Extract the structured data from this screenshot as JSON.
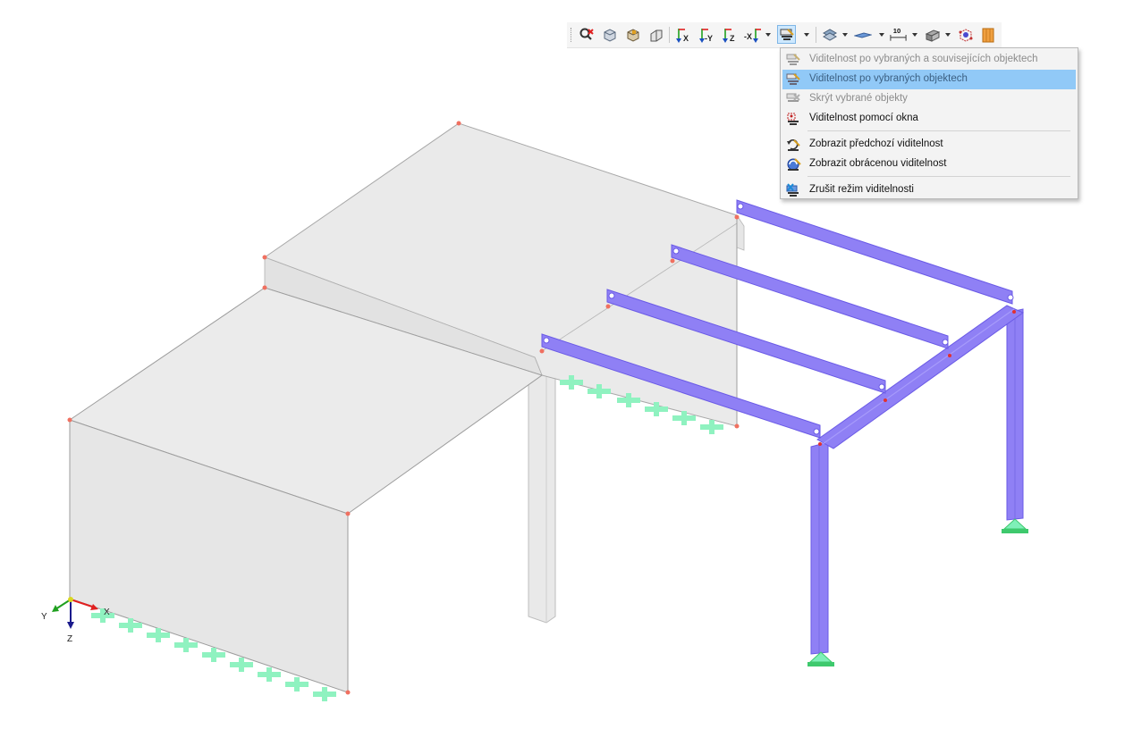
{
  "toolbar": {
    "buttons": [
      {
        "name": "hide-selection-icon"
      },
      {
        "name": "view-isometric-icon"
      },
      {
        "name": "view-box-icon"
      },
      {
        "name": "view-wire-icon"
      },
      {
        "name": "view-along-x-icon",
        "label": "X"
      },
      {
        "name": "view-along-y-icon",
        "label": "-Y"
      },
      {
        "name": "view-along-z-icon",
        "label": "Z"
      },
      {
        "name": "view-along-neg-x-icon",
        "label": "-X"
      },
      {
        "name": "visibility-mode-icon"
      },
      {
        "name": "display-surfaces-icon"
      },
      {
        "name": "display-plane-icon"
      },
      {
        "name": "dimension-icon",
        "label": "10"
      },
      {
        "name": "render-style-icon"
      },
      {
        "name": "wireframe-nodes-icon"
      },
      {
        "name": "solid-render-icon"
      }
    ]
  },
  "menu": {
    "items": [
      {
        "label": "Viditelnost po vybraných a souvisejících objektech",
        "state": "disabled",
        "icon": "visibility-related-icon"
      },
      {
        "label": "Viditelnost po vybraných objektech",
        "state": "highlighted",
        "icon": "visibility-selected-icon"
      },
      {
        "label": "Skrýt vybrané objekty",
        "state": "disabled",
        "icon": "hide-objects-icon"
      },
      {
        "label": "Viditelnost pomocí okna",
        "state": "enabled",
        "icon": "visibility-window-icon"
      },
      {
        "label": "Zobrazit předchozí viditelnost",
        "state": "enabled",
        "icon": "previous-visibility-icon"
      },
      {
        "label": "Zobrazit obrácenou viditelnost",
        "state": "enabled",
        "icon": "inverse-visibility-icon"
      },
      {
        "label": "Zrušit režim viditelnosti",
        "state": "enabled",
        "icon": "cancel-visibility-icon"
      }
    ]
  },
  "axes": {
    "x": "X",
    "y": "Y",
    "z": "Z"
  },
  "colors": {
    "member": "#8f80f5",
    "member_edge": "#6a5ae6",
    "surface": "#e8e8e8",
    "surface_edge": "#9c9c9c",
    "support": "#7ff0b8",
    "support_dark": "#3ec96d",
    "node": "#f07060",
    "menu_highlight": "#91c9f7"
  }
}
